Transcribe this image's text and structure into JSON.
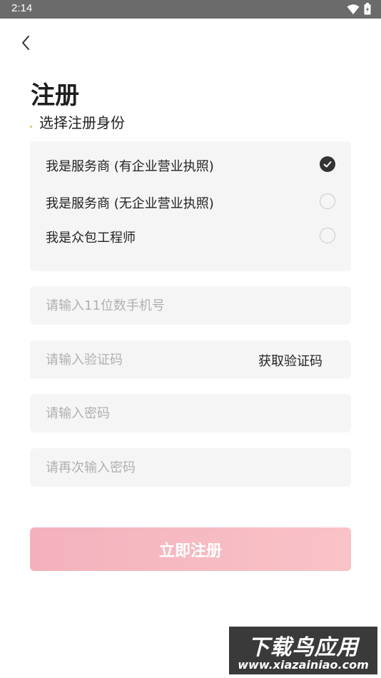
{
  "status_bar": {
    "time": "2:14",
    "icons": [
      "wifi-icon",
      "battery-icon"
    ]
  },
  "header": {
    "back_icon": "chevron-left-icon"
  },
  "page": {
    "title": "注册",
    "section_title": "选择注册身份"
  },
  "roles": [
    {
      "label": "我是服务商 (有企业营业执照)",
      "selected": true
    },
    {
      "label": "我是服务商 (无企业营业执照)",
      "selected": false
    },
    {
      "label": "我是众包工程师",
      "selected": false
    }
  ],
  "form": {
    "phone_placeholder": "请输入11位数手机号",
    "code_placeholder": "请输入验证码",
    "get_code_label": "获取验证码",
    "password_placeholder": "请输入密码",
    "confirm_password_placeholder": "请再次输入密码"
  },
  "submit": {
    "label": "立即注册"
  },
  "watermark": {
    "title": "下载鸟应用",
    "url": "www.xiazainiao.com"
  },
  "colors": {
    "accent": "#f5b7c0",
    "field_bg": "#f5f5f5",
    "checked": "#333333"
  }
}
